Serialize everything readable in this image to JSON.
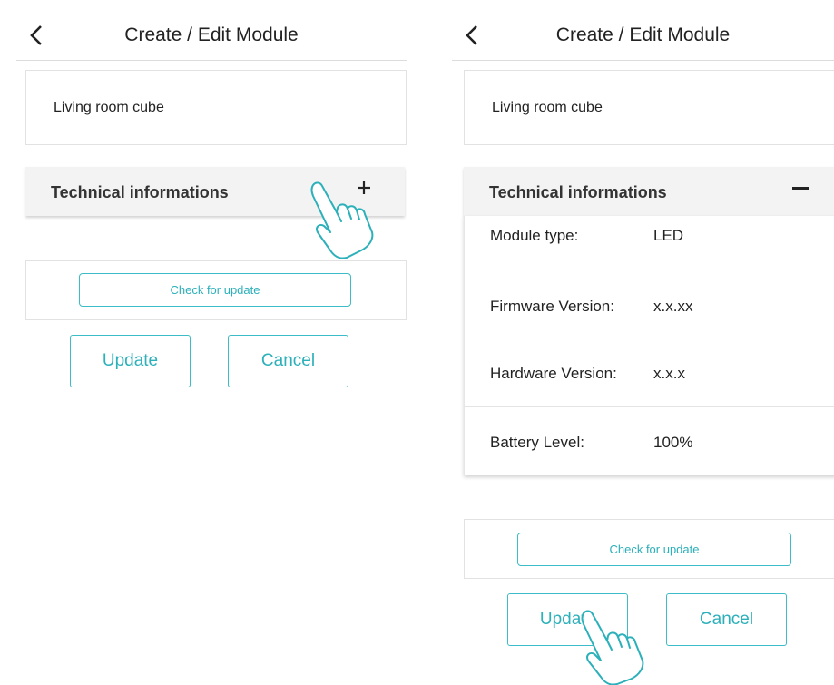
{
  "left_screen": {
    "header": {
      "title": "Create / Edit Module"
    },
    "module_name": "Living room cube",
    "technical_section": {
      "label": "Technical informations",
      "expanded": false
    },
    "check_update_label": "Check for update",
    "update_label": "Update",
    "cancel_label": "Cancel"
  },
  "right_screen": {
    "header": {
      "title": "Create / Edit Module"
    },
    "module_name": "Living room cube",
    "technical_section": {
      "label": "Technical informations",
      "expanded": true
    },
    "info_rows": [
      {
        "label": "Module type:",
        "value": "LED"
      },
      {
        "label": "Firmware Version:",
        "value": "x.x.xx"
      },
      {
        "label": "Hardware Version:",
        "value": "x.x.x"
      },
      {
        "label": "Battery Level:",
        "value": "100%"
      }
    ],
    "check_update_label": "Check for update",
    "update_label": "Update",
    "cancel_label": "Cancel"
  },
  "icons": {
    "back": "chevron-left-icon",
    "expand": "plus-icon",
    "collapse": "minus-icon",
    "pointer": "pointing-hand-icon"
  },
  "colors": {
    "accent": "#3bbcc6",
    "section_bg": "#f3f3f3",
    "text": "#222222"
  }
}
